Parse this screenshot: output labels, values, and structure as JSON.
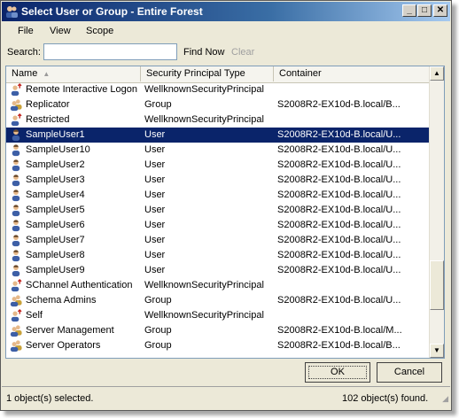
{
  "window": {
    "title": "Select User or Group - Entire Forest"
  },
  "menu": [
    {
      "label": "File"
    },
    {
      "label": "View"
    },
    {
      "label": "Scope"
    }
  ],
  "search": {
    "label": "Search:",
    "value": "",
    "find_now": "Find Now",
    "clear": "Clear"
  },
  "list": {
    "columns": [
      "Name",
      "Security Principal Type",
      "Container"
    ],
    "rows": [
      {
        "name": "Remote Interactive Logon",
        "type": "WellknownSecurityPrincipal",
        "container": "",
        "icon": "wellknown-principal-icon"
      },
      {
        "name": "Replicator",
        "type": "Group",
        "container": "S2008R2-EX10d-B.local/B...",
        "icon": "group-icon"
      },
      {
        "name": "Restricted",
        "type": "WellknownSecurityPrincipal",
        "container": "",
        "icon": "wellknown-principal-icon"
      },
      {
        "name": "SampleUser1",
        "type": "User",
        "container": "S2008R2-EX10d-B.local/U...",
        "icon": "user-icon",
        "selected": true
      },
      {
        "name": "SampleUser10",
        "type": "User",
        "container": "S2008R2-EX10d-B.local/U...",
        "icon": "user-icon"
      },
      {
        "name": "SampleUser2",
        "type": "User",
        "container": "S2008R2-EX10d-B.local/U...",
        "icon": "user-icon"
      },
      {
        "name": "SampleUser3",
        "type": "User",
        "container": "S2008R2-EX10d-B.local/U...",
        "icon": "user-icon"
      },
      {
        "name": "SampleUser4",
        "type": "User",
        "container": "S2008R2-EX10d-B.local/U...",
        "icon": "user-icon"
      },
      {
        "name": "SampleUser5",
        "type": "User",
        "container": "S2008R2-EX10d-B.local/U...",
        "icon": "user-icon"
      },
      {
        "name": "SampleUser6",
        "type": "User",
        "container": "S2008R2-EX10d-B.local/U...",
        "icon": "user-icon"
      },
      {
        "name": "SampleUser7",
        "type": "User",
        "container": "S2008R2-EX10d-B.local/U...",
        "icon": "user-icon"
      },
      {
        "name": "SampleUser8",
        "type": "User",
        "container": "S2008R2-EX10d-B.local/U...",
        "icon": "user-icon"
      },
      {
        "name": "SampleUser9",
        "type": "User",
        "container": "S2008R2-EX10d-B.local/U...",
        "icon": "user-icon"
      },
      {
        "name": "SChannel Authentication",
        "type": "WellknownSecurityPrincipal",
        "container": "",
        "icon": "wellknown-principal-icon"
      },
      {
        "name": "Schema Admins",
        "type": "Group",
        "container": "S2008R2-EX10d-B.local/U...",
        "icon": "group-icon"
      },
      {
        "name": "Self",
        "type": "WellknownSecurityPrincipal",
        "container": "",
        "icon": "wellknown-principal-icon"
      },
      {
        "name": "Server Management",
        "type": "Group",
        "container": "S2008R2-EX10d-B.local/M...",
        "icon": "group-icon"
      },
      {
        "name": "Server Operators",
        "type": "Group",
        "container": "S2008R2-EX10d-B.local/B...",
        "icon": "group-icon"
      }
    ]
  },
  "buttons": {
    "ok": "OK",
    "cancel": "Cancel"
  },
  "status": {
    "selected": "1 object(s) selected.",
    "found": "102 object(s) found."
  },
  "colors": {
    "titlebar": "#0a246a",
    "selection": "#0a246a",
    "window_bg": "#ece9d8"
  }
}
